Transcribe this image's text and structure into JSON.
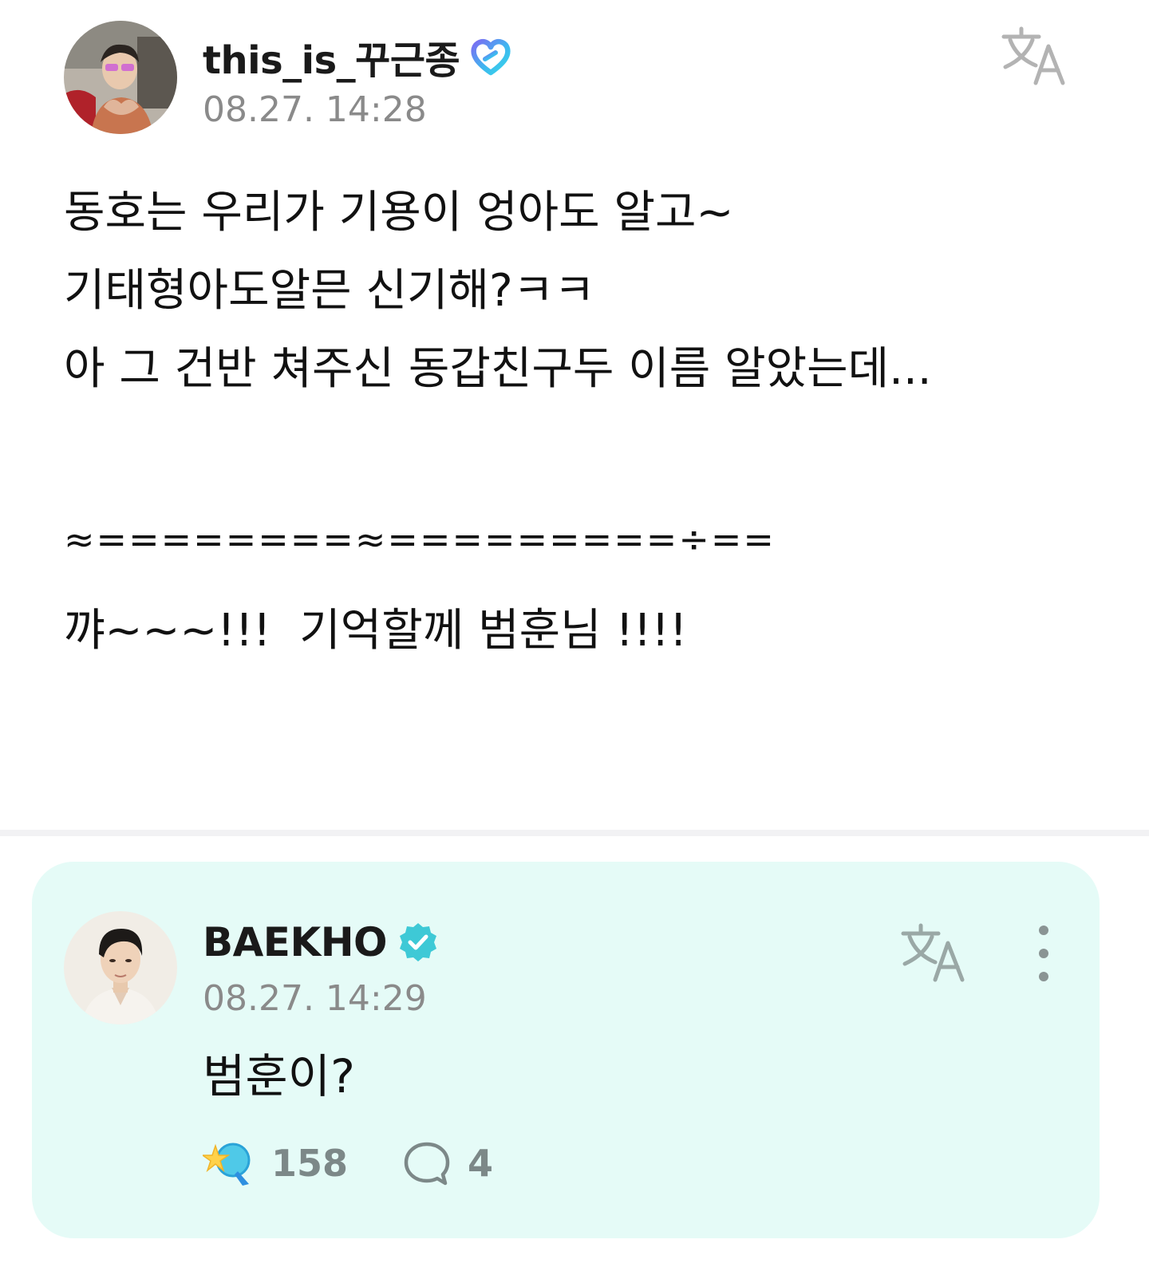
{
  "post": {
    "author": "this_is_꾸근종",
    "timestamp": "08.27. 14:28",
    "lines": [
      "동호는 우리가 기용이 엉아도 알고~",
      "기태형아도알믄 신기해?ㅋㅋ",
      "아 그 건반 쳐주신 동갑친구두 이름 알았는데...",
      "",
      "≈========≈=========÷==",
      "꺄~~~!!!  기억할께 범훈님 !!!!"
    ]
  },
  "reply": {
    "author": "BAEKHO",
    "timestamp": "08.27. 14:29",
    "text": "범훈이?",
    "likes": "158",
    "comments": "4"
  },
  "colors": {
    "reply_background": "#e5fbf7",
    "timestamp": "#8a8a8a",
    "stat_number": "#7c8888",
    "verified_badge": "#3ec9d6"
  },
  "icons": {
    "fan_badge": "heart-badge-icon",
    "verified_badge": "verified-check-icon",
    "translate": "translate-icon",
    "more": "more-vertical-icon",
    "like": "like-sticker-icon",
    "comment": "comment-bubble-icon"
  }
}
